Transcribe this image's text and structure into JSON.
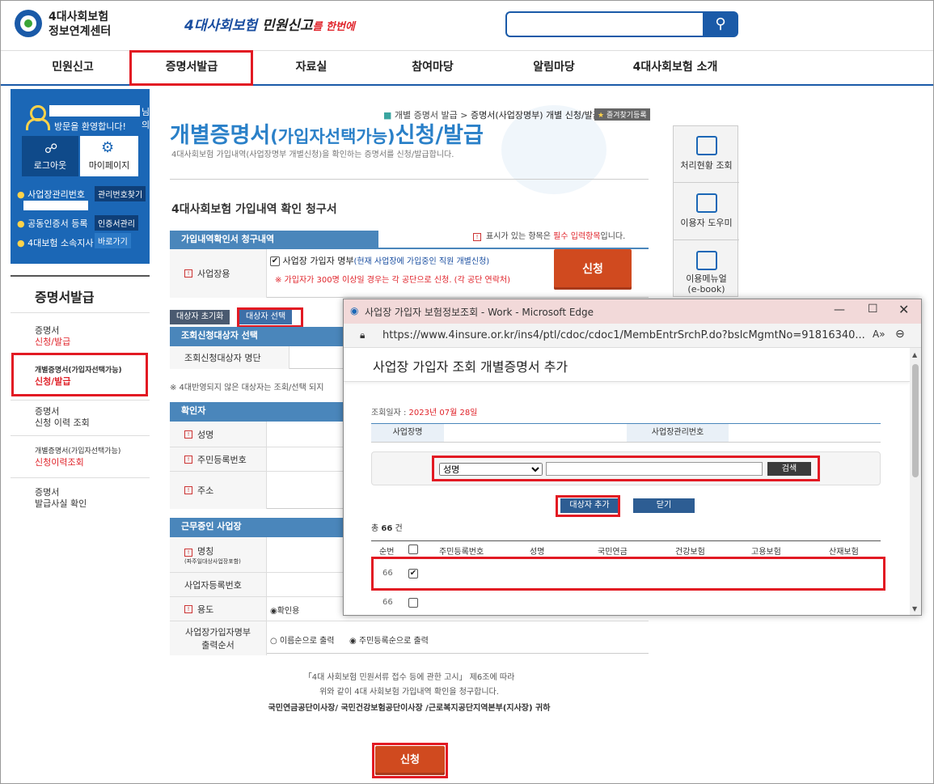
{
  "header": {
    "logo_line1": "4대사회보험",
    "logo_line2": "정보연계센터",
    "slogan_a": "4대사회보험",
    "slogan_b": "민원신고",
    "slogan_c": "를 한번에"
  },
  "gnb": [
    "민원신고",
    "증명서발급",
    "자료실",
    "참여마당",
    "알림마당",
    "4대사회보험 소개"
  ],
  "login": {
    "greeting_suffix": "님의",
    "welcome": "방문을 환영합니다!",
    "logout": "로그아웃",
    "mypage": "마이페이지",
    "mgmt_no": "사업장관리번호",
    "mgmt_find": "관리번호찾기",
    "cert_reg": "공동인증서 등록",
    "cert_mgmt": "인증서관리",
    "branch": "4대보험 소속지사",
    "go": "바로가기"
  },
  "lnb": {
    "title": "증명서발급",
    "items": [
      {
        "l1": "증명서",
        "l2": "신청/발급"
      },
      {
        "l1": "개별증명서(가입자선택가능)",
        "l2": "신청/발급"
      },
      {
        "l1": "증명서",
        "l2": "신청 이력 조회"
      },
      {
        "l1": "개별증명서(가입자선택가능)",
        "l2": "신청이력조회"
      },
      {
        "l1": "증명서",
        "l2": "발급사실 확인"
      }
    ]
  },
  "main": {
    "breadcrumb_pre": "개별 증명서 발급 > ",
    "breadcrumb_cur": "증명서(사업장명부) 개별 신청/발급",
    "fav": "즐겨찾기등록",
    "title_a": "개별증명서",
    "title_b": "(가입자선택가능)",
    "title_c": "신청/발급",
    "subtitle": "4대사회보험 가입내역(사업장명부 개별신청)을 확인하는 증명서를 신청/발급합니다.",
    "section": "4대사회보험 가입내역 확인 청구서",
    "tab1": "가입내역확인서 청구내역",
    "req_note_a": "표시가 있는 항목은 ",
    "req_note_b": "필수 입력항목",
    "req_note_c": "입니다.",
    "row_business": "사업장용",
    "opt_label": "사업장 가입자 명부",
    "opt_paren": "(현재 사업장에 가입중인 직원 개별신청)",
    "warning": "※ 가입자가 300명 이상일 경우는 각 공단으로 신청. (각 공단 연락처)",
    "apply": "신청",
    "btn_reset": "대상자 초기화",
    "btn_select": "대상자 선택",
    "tab2": "조회신청대상자 선택",
    "row_list": "조회신청대상자 명단",
    "note_unreflected": "※ 4대반영되지 않은 대상자는 조회/선택 되지",
    "tab3": "확인자",
    "row_name": "성명",
    "row_rrn": "주민등록번호",
    "row_addr": "주소",
    "tab4": "근무중인 사업장",
    "row_bizname": "명칭",
    "row_bizname_sub": "(파주일대상사업장포함)",
    "row_bizno": "사업자등록번호",
    "row_use": "용도",
    "use_opt": "확인용",
    "row_order_1": "사업장가입자명부",
    "row_order_2": "출력순서",
    "order_opt1": "이름순으로 출력",
    "order_opt2": "주민등록순으로 출력",
    "footer_1": "「4대 사회보험 민원서류 접수 등에 관한 고시」 제6조에 따라",
    "footer_2": "위와 같이 4대 사회보험 가입내역 확인을 청구합니다.",
    "footer_3": "국민연금공단이사장/ 국민건강보험공단이사장 /근로복지공단지역본부(지사장) 귀하",
    "apply_bottom": "신청"
  },
  "quick": [
    "처리현황 조회",
    "이용자 도우미",
    "이용메뉴얼",
    "(e-book)"
  ],
  "popup": {
    "window_title": "사업장 가입자 보험정보조회 - Work - Microsoft Edge",
    "url": "https://www.4insure.or.kr/ins4/ptl/cdoc/cdoc1/MembEntrSrchP.do?bslcMgmtNo=91816340...",
    "heading": "사업장 가입자 조회 개별증명서 추가",
    "date_label": "조회일자 : ",
    "date_value": "2023년 07월 28일",
    "col_bizname": "사업장명",
    "col_bizno": "사업장관리번호",
    "search_select": "성명",
    "search_btn": "검색",
    "btn_add": "대상자 추가",
    "btn_close": "닫기",
    "total_a": "총 ",
    "total_b": "66",
    "total_c": " 건",
    "columns": [
      "순번",
      "주민등록번호",
      "성명",
      "국민연금",
      "건강보험",
      "고용보험",
      "산재보험"
    ],
    "rows": [
      {
        "no": "66",
        "checked": true
      },
      {
        "no": "66",
        "checked": false
      }
    ]
  }
}
